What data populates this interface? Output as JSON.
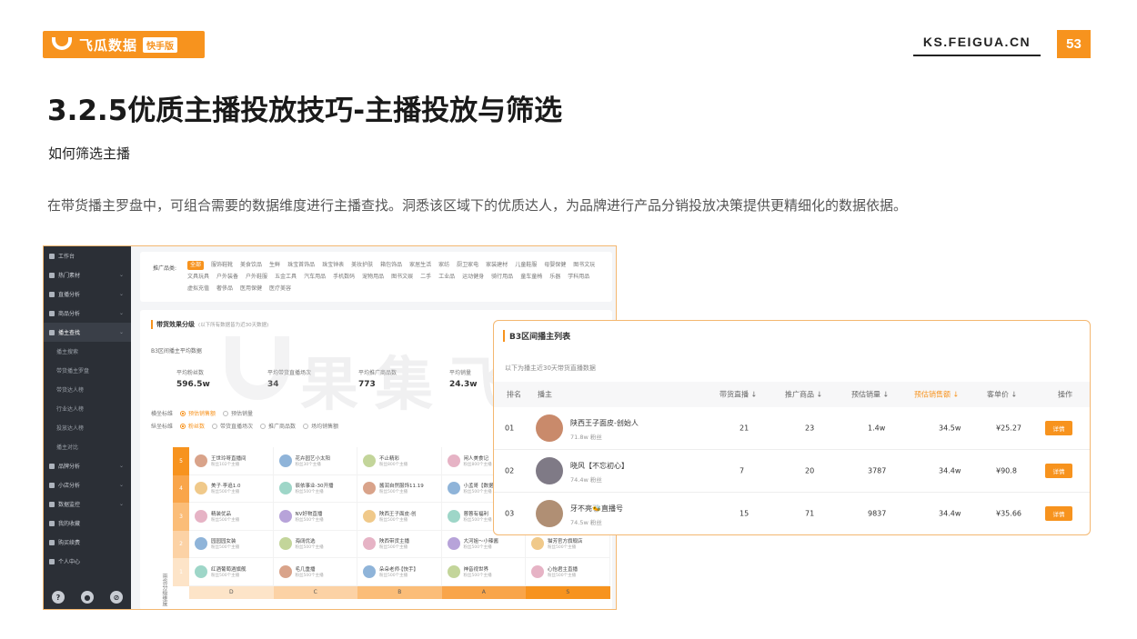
{
  "brand": {
    "name": "飞瓜数据",
    "tag": "快手版"
  },
  "site": "KS.FEIGUA.CN",
  "page_number": "53",
  "title": "3.2.5优质主播投放技巧-主播投放与筛选",
  "subtitle": "如何筛选主播",
  "description": "在带货播主罗盘中，可组合需要的数据维度进行主播查找。洞悉该区域下的优质达人，为品牌进行产品分销投放决策提供更精细化的数据依据。",
  "sidebar": {
    "items": [
      {
        "label": "工作台",
        "sub": false
      },
      {
        "label": "热门素材",
        "sub": false
      },
      {
        "label": "直播分析",
        "sub": false
      },
      {
        "label": "商品分析",
        "sub": false
      },
      {
        "label": "播主查找",
        "sub": false,
        "active": true
      },
      {
        "label": "播主搜索",
        "sub": true
      },
      {
        "label": "带货播主罗盘",
        "sub": true
      },
      {
        "label": "带货达人榜",
        "sub": true
      },
      {
        "label": "行业达人榜",
        "sub": true
      },
      {
        "label": "投放达人榜",
        "sub": true
      },
      {
        "label": "播主对比",
        "sub": true
      },
      {
        "label": "品牌分析",
        "sub": false
      },
      {
        "label": "小店分析",
        "sub": false
      },
      {
        "label": "数据监控",
        "sub": false
      },
      {
        "label": "我的收藏",
        "sub": false
      },
      {
        "label": "购买续费",
        "sub": false
      },
      {
        "label": "个人中心",
        "sub": false
      }
    ]
  },
  "categories": {
    "label": "推广品类:",
    "items": [
      "全部",
      "服饰鞋靴",
      "美食饮品",
      "生鲜",
      "珠宝首饰品",
      "珠宝钟表",
      "美妆护肤",
      "箱包饰品",
      "家居生活",
      "家纺",
      "厨卫家电",
      "家装建材",
      "儿童鞋服",
      "母婴保健",
      "图书文玩",
      "文具玩具",
      "户外装备",
      "户外鞋服",
      "五金工具",
      "汽车用品",
      "手机数码",
      "宠物用品",
      "图书文娱",
      "二手",
      "工业品",
      "运动健身",
      "骑行用品",
      "童车童椅",
      "乐器",
      "学科用品",
      "虚拟充值",
      "奢侈品",
      "医用保健",
      "医疗美容"
    ]
  },
  "compass": {
    "title": "带货效果分级",
    "note": "(以下所有数据皆为近30天数据)",
    "sub": "B3区间播主平均数据",
    "stats": [
      {
        "label": "平均粉丝数",
        "value": "596.5w"
      },
      {
        "label": "平均带货直播场次",
        "value": "34"
      },
      {
        "label": "平均推广商品数",
        "value": "773"
      },
      {
        "label": "平均销量",
        "value": "24.3w"
      }
    ],
    "filter1_label": "横坐标维",
    "filter1": [
      "预估销售额",
      "预估销量"
    ],
    "filter2_label": "纵坐标维",
    "filter2": [
      "粉丝数",
      "带货直播场次",
      "推广商品数",
      "场均销售额"
    ],
    "levels": [
      "5",
      "4",
      "3",
      "2",
      "1"
    ],
    "x_axis": [
      "D",
      "C",
      "B",
      "A",
      "S"
    ],
    "y_axis_label": "带货分级维度",
    "rows": [
      [
        {
          "name": "王世玲呀直播间",
          "fans": "粉丝102个主播"
        },
        {
          "name": "花卉园艺小太阳",
          "fans": "粉丝30个主播"
        },
        {
          "name": "不止精彩",
          "fans": "粉丝800个主播"
        },
        {
          "name": "闲人美食记",
          "fans": "粉丝800个主播"
        }
      ],
      [
        {
          "name": "美子·李追1.0",
          "fans": "粉丝500个主播"
        },
        {
          "name": "辰依事业-30开播",
          "fans": "粉丝500个主播"
        },
        {
          "name": "酱润自然服饰11.19",
          "fans": "粉丝500个主播"
        },
        {
          "name": "小孟哥【数据】",
          "fans": "粉丝500个主播"
        }
      ],
      [
        {
          "name": "精装优品",
          "fans": "粉丝500个主播"
        },
        {
          "name": "NV好物直播",
          "fans": "粉丝500个主播"
        },
        {
          "name": "陕西王子面皮-创",
          "fans": "粉丝500个主播"
        },
        {
          "name": "蓉蓉有福利",
          "fans": "粉丝500个主播"
        }
      ],
      [
        {
          "name": "园园园女装",
          "fans": "粉丝500个主播"
        },
        {
          "name": "海阔优选",
          "fans": "粉丝500个主播"
        },
        {
          "name": "陕西带货主播",
          "fans": "粉丝500个主播"
        },
        {
          "name": "大河姐～小辣酱",
          "fans": "粉丝500个主播"
        },
        {
          "name": "猫芳官方旗舰店",
          "fans": "粉丝500个主播"
        }
      ],
      [
        {
          "name": "红酒葡萄酒旗舰",
          "fans": "粉丝500个主播"
        },
        {
          "name": "毛几重播",
          "fans": "粉丝500个主播"
        },
        {
          "name": "朵朵老师·【快手】",
          "fans": "粉丝500个主播"
        },
        {
          "name": "神音视世界",
          "fans": "粉丝500个主播"
        },
        {
          "name": "心怡君主直播",
          "fans": "粉丝500个主播"
        }
      ]
    ]
  },
  "list_panel": {
    "title": "B3区间播主列表",
    "sub": "以下为播主近30天带货直播数据",
    "headers": [
      "排名",
      "播主",
      "带货直播 ↓",
      "推广商品 ↓",
      "预估销量 ↓",
      "预估销售额 ↓",
      "客单价 ↓",
      "操作"
    ],
    "rows": [
      {
        "rank": "01",
        "name": "陕西王子面皮-创始人",
        "fans": "71.8w 粉丝",
        "lives": "21",
        "products": "23",
        "sales": "1.4w",
        "gmv": "34.5w",
        "price": "¥25.27",
        "action": "详情"
      },
      {
        "rank": "02",
        "name": "晓风【不忘初心】",
        "fans": "74.4w 粉丝",
        "lives": "7",
        "products": "20",
        "sales": "3787",
        "gmv": "34.4w",
        "price": "¥90.8",
        "action": "详情"
      },
      {
        "rank": "03",
        "name": "牙不亮🐝直播号",
        "fans": "74.5w 粉丝",
        "lives": "15",
        "products": "71",
        "sales": "9837",
        "gmv": "34.4w",
        "price": "¥35.66",
        "action": "详情"
      }
    ]
  },
  "watermark": {
    "text": "果集飞瓜",
    "tag": "快手版"
  },
  "colors": {
    "accent": "#f7931e",
    "sidebar": "#2b2f36",
    "level_colors": [
      "#f7931e",
      "#f9a54a",
      "#fbbd78",
      "#fcd2a5",
      "#fde4c8"
    ]
  }
}
